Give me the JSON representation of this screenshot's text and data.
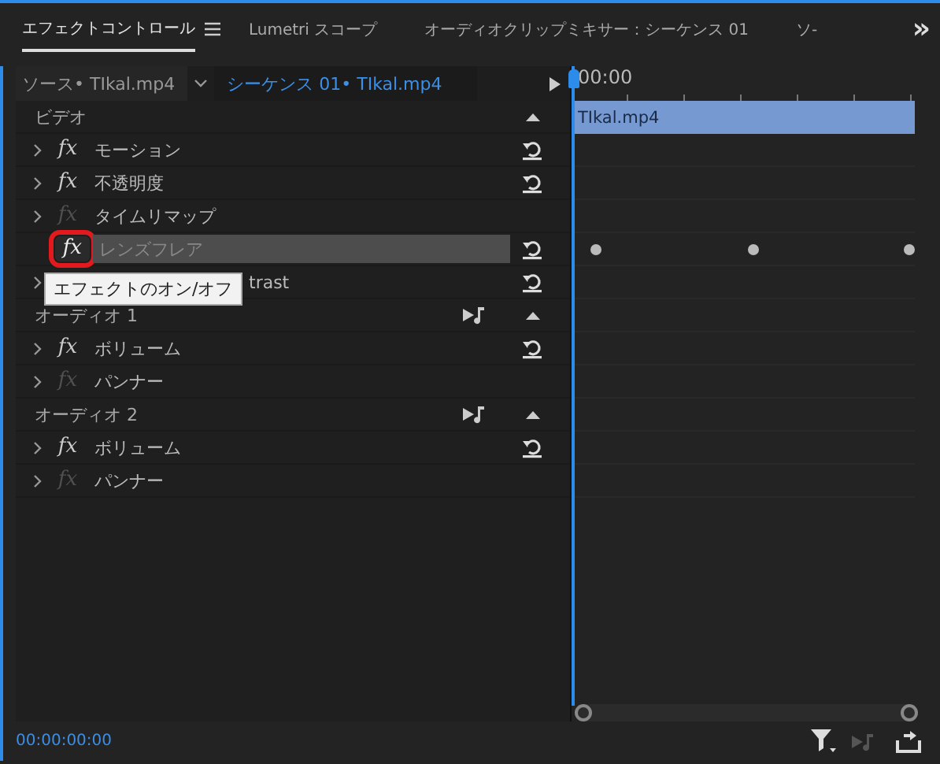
{
  "tabs": [
    {
      "label": "エフェクトコントロール",
      "selected": true
    },
    {
      "label": "Lumetri スコープ",
      "selected": false
    },
    {
      "label": "オーディオクリップミキサー：シーケンス 01",
      "selected": false
    },
    {
      "label": "ソ-",
      "selected": false
    }
  ],
  "overflow": "»",
  "source": {
    "source_clip": "ソース• TIkal.mp4",
    "sequence_clip": "シーケンス 01• TIkal.mp4"
  },
  "timeline": {
    "ruler_time": "00:00",
    "clip": "TIkal.mp4"
  },
  "rows": [
    {
      "kind": "header",
      "label": "ビデオ",
      "audio": false
    },
    {
      "kind": "effect",
      "fx": "fx",
      "label": "モーション",
      "fx_enabled": true,
      "selected": false,
      "reset": true,
      "keyframes": false
    },
    {
      "kind": "effect",
      "fx": "fx",
      "label": "不透明度",
      "fx_enabled": true,
      "selected": false,
      "reset": true,
      "keyframes": false
    },
    {
      "kind": "effect",
      "fx": "fx",
      "label": "タイムリマップ",
      "fx_enabled": false,
      "selected": false,
      "reset": false,
      "keyframes": false
    },
    {
      "kind": "effect",
      "fx": "fx",
      "label": "レンズフレア",
      "fx_enabled": true,
      "selected": true,
      "reset": true,
      "keyframes": true
    },
    {
      "kind": "effect",
      "label": "trast",
      "reset": true,
      "keyframes": false
    },
    {
      "kind": "header",
      "label": "オーディオ 1",
      "audio": true
    },
    {
      "kind": "effect",
      "fx": "fx",
      "label": "ボリューム",
      "fx_enabled": true,
      "selected": false,
      "reset": true,
      "keyframes": false
    },
    {
      "kind": "effect",
      "fx": "fx",
      "label": "パンナー",
      "fx_enabled": false,
      "selected": false,
      "reset": false,
      "keyframes": false
    },
    {
      "kind": "header",
      "label": "オーディオ 2",
      "audio": true
    },
    {
      "kind": "effect",
      "fx": "fx",
      "label": "ボリューム",
      "fx_enabled": true,
      "selected": false,
      "reset": true,
      "keyframes": false
    },
    {
      "kind": "effect",
      "fx": "fx",
      "label": "パンナー",
      "fx_enabled": false,
      "selected": false,
      "reset": false,
      "keyframes": false
    }
  ],
  "tooltip": "エフェクトのオン/オフ",
  "status": {
    "timecode": "00:00:00:00"
  }
}
